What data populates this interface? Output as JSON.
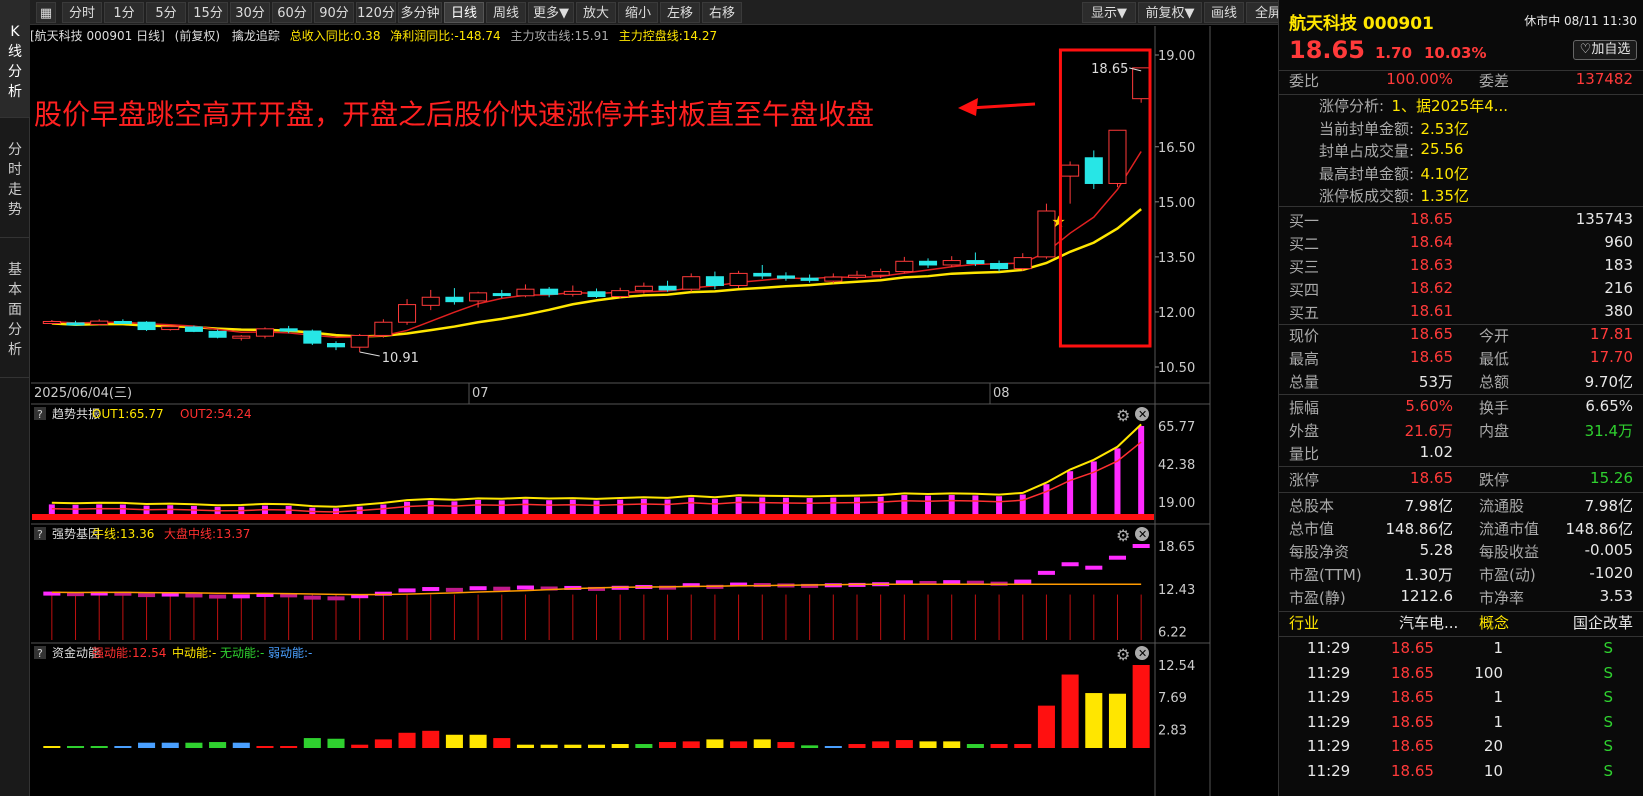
{
  "left_tabs": [
    "K线分析",
    "分时走势",
    "基本面分析"
  ],
  "toolbar": {
    "buttons": [
      "分时",
      "1分",
      "5分",
      "15分",
      "30分",
      "60分",
      "90分",
      "120分",
      "多分钟",
      "日线",
      "周线",
      "更多▼",
      "放大",
      "缩小",
      "左移",
      "右移"
    ],
    "active": "日线",
    "right_buttons": [
      "显示▼",
      "前复权▼",
      "画线",
      "全屏"
    ]
  },
  "infobar": {
    "title": "[航天科技 000901 日线]",
    "adj": "(前复权)",
    "indicator": "擒龙追踪",
    "rev": "总收入同比:0.38",
    "profit": "净利润同比:-148.74",
    "attack": "主力攻击线:15.91",
    "control": "主力控盘线:14.27"
  },
  "annotation": "股价早盘跳空高开开盘，开盘之后股价快速涨停并封板直至午盘收盘",
  "panels": {
    "trend": {
      "name": "趋势共振",
      "l1": "OUT1:65.77",
      "l2": "OUT2:54.24",
      "ticks": [
        "65.77",
        "42.38",
        "19.00"
      ]
    },
    "strong": {
      "name": "强势基因",
      "l1": "牛线:13.36",
      "l2": "大盘中线:13.37",
      "ticks": [
        "18.65",
        "12.43",
        "6.22"
      ]
    },
    "fund": {
      "name": "资金动能",
      "l1": "强动能:12.54",
      "l2": "中动能:-",
      "l3": "无动能:-",
      "l4": "弱动能:-",
      "ticks": [
        "12.54",
        "7.69",
        "2.83"
      ]
    }
  },
  "chart_data": {
    "type": "candlestick",
    "y_ticks": [
      "19.00",
      "16.50",
      "15.00",
      "13.50",
      "12.00",
      "10.50"
    ],
    "ylim": [
      10.5,
      19.0
    ],
    "x_labels": [
      "2025/06/04(三)",
      "07",
      "08"
    ],
    "low_label": "10.91",
    "high_label": "18.65",
    "candles": [
      [
        11.72,
        11.78,
        11.67,
        11.74
      ],
      [
        11.7,
        11.76,
        11.62,
        11.66
      ],
      [
        11.66,
        11.8,
        11.63,
        11.75
      ],
      [
        11.74,
        11.8,
        11.69,
        11.72
      ],
      [
        11.72,
        11.75,
        11.48,
        11.52
      ],
      [
        11.52,
        11.62,
        11.49,
        11.6
      ],
      [
        11.59,
        11.63,
        11.45,
        11.47
      ],
      [
        11.47,
        11.52,
        11.28,
        11.31
      ],
      [
        11.3,
        11.37,
        11.22,
        11.34
      ],
      [
        11.34,
        11.58,
        11.28,
        11.54
      ],
      [
        11.54,
        11.62,
        11.42,
        11.48
      ],
      [
        11.48,
        11.52,
        11.1,
        11.15
      ],
      [
        11.14,
        11.2,
        10.96,
        11.05
      ],
      [
        11.04,
        11.4,
        10.91,
        11.36
      ],
      [
        11.36,
        11.8,
        11.3,
        11.72
      ],
      [
        11.72,
        12.35,
        11.65,
        12.2
      ],
      [
        12.18,
        12.6,
        12.05,
        12.4
      ],
      [
        12.4,
        12.65,
        12.2,
        12.28
      ],
      [
        12.3,
        12.55,
        12.12,
        12.52
      ],
      [
        12.5,
        12.6,
        12.38,
        12.45
      ],
      [
        12.44,
        12.75,
        12.4,
        12.62
      ],
      [
        12.62,
        12.68,
        12.4,
        12.48
      ],
      [
        12.48,
        12.72,
        12.42,
        12.56
      ],
      [
        12.55,
        12.64,
        12.38,
        12.42
      ],
      [
        12.42,
        12.66,
        12.36,
        12.58
      ],
      [
        12.58,
        12.8,
        12.5,
        12.7
      ],
      [
        12.7,
        12.85,
        12.55,
        12.6
      ],
      [
        12.62,
        13.05,
        12.55,
        12.96
      ],
      [
        12.96,
        13.1,
        12.62,
        12.72
      ],
      [
        12.72,
        13.12,
        12.65,
        13.05
      ],
      [
        13.05,
        13.28,
        12.9,
        12.98
      ],
      [
        12.98,
        13.08,
        12.85,
        12.92
      ],
      [
        12.92,
        13.02,
        12.8,
        12.86
      ],
      [
        12.84,
        13.05,
        12.78,
        12.95
      ],
      [
        12.95,
        13.12,
        12.9,
        13.0
      ],
      [
        13.0,
        13.18,
        12.92,
        13.1
      ],
      [
        13.1,
        13.5,
        13.05,
        13.38
      ],
      [
        13.38,
        13.46,
        13.2,
        13.28
      ],
      [
        13.28,
        13.52,
        13.22,
        13.4
      ],
      [
        13.4,
        13.62,
        13.25,
        13.32
      ],
      [
        13.32,
        13.4,
        13.1,
        13.18
      ],
      [
        13.18,
        13.6,
        13.12,
        13.48
      ],
      [
        13.5,
        14.95,
        13.45,
        14.75
      ],
      [
        15.7,
        16.1,
        14.95,
        16.0
      ],
      [
        16.2,
        16.4,
        15.35,
        15.5
      ],
      [
        15.5,
        16.95,
        15.4,
        16.95
      ],
      [
        17.81,
        18.65,
        17.7,
        18.65
      ]
    ]
  },
  "quote": {
    "name": "航天科技",
    "code": "000901",
    "status": "休市中 08/11 11:30",
    "price": "18.65",
    "change": "1.70",
    "pct": "10.03%",
    "btn": "♡加自选",
    "wb_label": "委比",
    "wb": "100.00%",
    "wc_label": "委差",
    "wc": "137482",
    "limit": [
      {
        "k": "涨停分析:",
        "v": "1、据2025年4..."
      },
      {
        "k": "当前封单金额:",
        "v": "2.53亿"
      },
      {
        "k": "封单占成交量:",
        "v": "25.56"
      },
      {
        "k": "最高封单金额:",
        "v": "4.10亿"
      },
      {
        "k": "涨停板成交额:",
        "v": "1.35亿"
      }
    ],
    "bids": [
      {
        "k": "买一",
        "p": "18.65",
        "v": "135743"
      },
      {
        "k": "买二",
        "p": "18.64",
        "v": "960"
      },
      {
        "k": "买三",
        "p": "18.63",
        "v": "183"
      },
      {
        "k": "买四",
        "p": "18.62",
        "v": "216"
      },
      {
        "k": "买五",
        "p": "18.61",
        "v": "380"
      }
    ],
    "stats1": [
      [
        "现价",
        "18.65",
        "今开",
        "17.81"
      ],
      [
        "最高",
        "18.65",
        "最低",
        "17.70"
      ],
      [
        "总量",
        "53万",
        "总额",
        "9.70亿"
      ]
    ],
    "stats2": [
      [
        "振幅",
        "5.60%",
        "换手",
        "6.65%"
      ],
      [
        "外盘",
        "21.6万",
        "内盘",
        "31.4万"
      ],
      [
        "量比",
        "1.02",
        "",
        ""
      ]
    ],
    "stats3": [
      [
        "涨停",
        "18.65",
        "跌停",
        "15.26"
      ]
    ],
    "stats4": [
      [
        "总股本",
        "7.98亿",
        "流通股",
        "7.98亿"
      ],
      [
        "总市值",
        "148.86亿",
        "流通市值",
        "148.86亿"
      ],
      [
        "每股净资",
        "5.28",
        "每股收益",
        "-0.005"
      ],
      [
        "市盈(TTM)",
        "1.30万",
        "市盈(动)",
        "-1020"
      ],
      [
        "市盈(静)",
        "1212.6",
        "市净率",
        "3.53"
      ]
    ],
    "industry": [
      "行业",
      "汽车电...",
      "概念",
      "国企改革"
    ],
    "ticks": [
      [
        "11:29",
        "18.65",
        "1",
        "S"
      ],
      [
        "11:29",
        "18.65",
        "100",
        "S"
      ],
      [
        "11:29",
        "18.65",
        "1",
        "S"
      ],
      [
        "11:29",
        "18.65",
        "1",
        "S"
      ],
      [
        "11:29",
        "18.65",
        "20",
        "S"
      ],
      [
        "11:29",
        "18.65",
        "10",
        "S"
      ]
    ]
  }
}
